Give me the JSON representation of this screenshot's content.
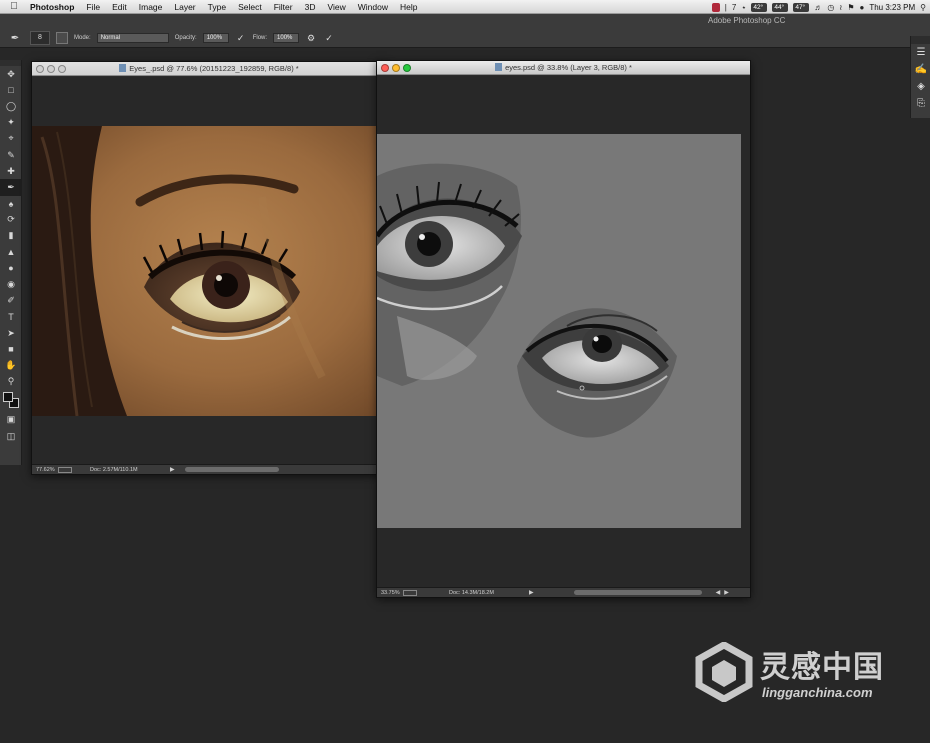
{
  "menubar": {
    "app_name": "Photoshop",
    "items": [
      "File",
      "Edit",
      "Image",
      "Layer",
      "Type",
      "Select",
      "Filter",
      "3D",
      "View",
      "Window",
      "Help"
    ],
    "status_items": [
      "7",
      "42°",
      "44°",
      "47°"
    ],
    "clock": "Thu 3:23 PM"
  },
  "app": {
    "title": "Adobe Photoshop CC"
  },
  "options_bar": {
    "brush_size": "8",
    "mode_label": "Mode:",
    "mode_value": "Normal",
    "opacity_label": "Opacity:",
    "opacity_value": "100%",
    "flow_label": "Flow:",
    "flow_value": "100%"
  },
  "tools": [
    "move-tool",
    "marquee-tool",
    "lasso-tool",
    "quick-selection-tool",
    "crop-tool",
    "eyedropper-tool",
    "spot-healing-tool",
    "brush-tool",
    "clone-stamp-tool",
    "history-brush-tool",
    "eraser-tool",
    "gradient-tool",
    "blur-tool",
    "dodge-tool",
    "pen-tool",
    "type-tool",
    "path-selection-tool",
    "rectangle-tool",
    "hand-tool",
    "zoom-tool"
  ],
  "windows": {
    "photo": {
      "title": "Eyes_.psd @ 77.6% (20151223_192859, RGB/8) *",
      "zoom": "77.62%",
      "doc_size": "Doc: 2.57M/110.1M"
    },
    "sketch": {
      "title": "eyes.psd @ 33.8% (Layer 3, RGB/8) *",
      "zoom": "33.75%",
      "doc_size": "Doc: 14.3M/18.2M"
    }
  },
  "watermark": {
    "cn": "灵感中国",
    "en": "lingganchina.com"
  },
  "colors": {
    "accent": "#3b3b3b",
    "canvas_grey": "#767676",
    "skin": "#9a6a3e"
  }
}
